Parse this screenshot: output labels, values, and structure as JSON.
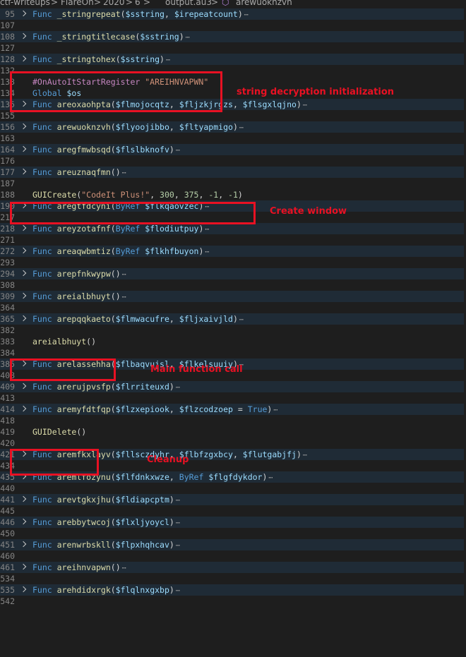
{
  "breadcrumb": {
    "items": [
      "ctf-writeups",
      "FlareOn",
      "2020",
      "6",
      "output.au3",
      "arewuoknzvh"
    ],
    "separator": ">"
  },
  "lines": [
    {
      "num": "95",
      "folded": true,
      "tokens": [
        [
          "kw",
          "Func "
        ],
        [
          "fn",
          "_stringrepeat"
        ],
        [
          "op",
          "("
        ],
        [
          "var",
          "$sstring"
        ],
        [
          "op",
          ", "
        ],
        [
          "var",
          "$irepeatcount"
        ],
        [
          "op",
          ")"
        ]
      ]
    },
    {
      "num": "107",
      "folded": false,
      "tokens": []
    },
    {
      "num": "108",
      "folded": true,
      "tokens": [
        [
          "kw",
          "Func "
        ],
        [
          "fn",
          "_stringtitlecase"
        ],
        [
          "op",
          "("
        ],
        [
          "var",
          "$sstring"
        ],
        [
          "op",
          ")"
        ]
      ]
    },
    {
      "num": "127",
      "folded": false,
      "tokens": []
    },
    {
      "num": "128",
      "folded": true,
      "tokens": [
        [
          "kw",
          "Func "
        ],
        [
          "fn",
          "_stringtohex"
        ],
        [
          "op",
          "("
        ],
        [
          "var",
          "$sstring"
        ],
        [
          "op",
          ")"
        ]
      ]
    },
    {
      "num": "132",
      "folded": false,
      "tokens": []
    },
    {
      "num": "133",
      "folded": false,
      "tokens": [
        [
          "dir",
          "#OnAutoItStartRegister "
        ],
        [
          "str",
          "\"AREIHNVAPWN\""
        ]
      ]
    },
    {
      "num": "134",
      "folded": false,
      "tokens": [
        [
          "kw",
          "Global "
        ],
        [
          "var",
          "$os"
        ]
      ]
    },
    {
      "num": "135",
      "folded": true,
      "tokens": [
        [
          "kw",
          "Func "
        ],
        [
          "fn",
          "areoxaohpta"
        ],
        [
          "op",
          "("
        ],
        [
          "var",
          "$flmojocqtz"
        ],
        [
          "op",
          ", "
        ],
        [
          "var",
          "$fljzkjrgzs"
        ],
        [
          "op",
          ", "
        ],
        [
          "var",
          "$flsgxlqjno"
        ],
        [
          "op",
          ")"
        ]
      ]
    },
    {
      "num": "155",
      "folded": false,
      "tokens": []
    },
    {
      "num": "156",
      "folded": true,
      "tokens": [
        [
          "kw",
          "Func "
        ],
        [
          "fn",
          "arewuoknzvh"
        ],
        [
          "op",
          "("
        ],
        [
          "var",
          "$flyoojibbo"
        ],
        [
          "op",
          ", "
        ],
        [
          "var",
          "$fltyapmigo"
        ],
        [
          "op",
          ")"
        ]
      ]
    },
    {
      "num": "163",
      "folded": false,
      "tokens": []
    },
    {
      "num": "164",
      "folded": true,
      "tokens": [
        [
          "kw",
          "Func "
        ],
        [
          "fn",
          "aregfmwbsqd"
        ],
        [
          "op",
          "("
        ],
        [
          "var",
          "$flslbknofv"
        ],
        [
          "op",
          ")"
        ]
      ]
    },
    {
      "num": "176",
      "folded": false,
      "tokens": []
    },
    {
      "num": "177",
      "folded": true,
      "tokens": [
        [
          "kw",
          "Func "
        ],
        [
          "fn",
          "areuznaqfmn"
        ],
        [
          "op",
          "()"
        ]
      ]
    },
    {
      "num": "187",
      "folded": false,
      "tokens": []
    },
    {
      "num": "188",
      "folded": false,
      "tokens": [
        [
          "fn",
          "GUICreate"
        ],
        [
          "op",
          "("
        ],
        [
          "str",
          "\"CodeIt Plus!\""
        ],
        [
          "op",
          ", "
        ],
        [
          "num",
          "300"
        ],
        [
          "op",
          ", "
        ],
        [
          "num",
          "375"
        ],
        [
          "op",
          ", "
        ],
        [
          "num",
          "-1"
        ],
        [
          "op",
          ", "
        ],
        [
          "num",
          "-1"
        ],
        [
          "op",
          ")"
        ]
      ]
    },
    {
      "num": "190",
      "folded": true,
      "tokens": [
        [
          "kw",
          "Func "
        ],
        [
          "fn",
          "aregtfdcyni"
        ],
        [
          "op",
          "("
        ],
        [
          "kw",
          "ByRef "
        ],
        [
          "var",
          "$flkqaovzec"
        ],
        [
          "op",
          ")"
        ]
      ]
    },
    {
      "num": "217",
      "folded": false,
      "tokens": []
    },
    {
      "num": "218",
      "folded": true,
      "tokens": [
        [
          "kw",
          "Func "
        ],
        [
          "fn",
          "areyzotafnf"
        ],
        [
          "op",
          "("
        ],
        [
          "kw",
          "ByRef "
        ],
        [
          "var",
          "$flodiutpuy"
        ],
        [
          "op",
          ")"
        ]
      ]
    },
    {
      "num": "271",
      "folded": false,
      "tokens": []
    },
    {
      "num": "272",
      "folded": true,
      "tokens": [
        [
          "kw",
          "Func "
        ],
        [
          "fn",
          "areaqwbmtiz"
        ],
        [
          "op",
          "("
        ],
        [
          "kw",
          "ByRef "
        ],
        [
          "var",
          "$flkhfbuyon"
        ],
        [
          "op",
          ")"
        ]
      ]
    },
    {
      "num": "293",
      "folded": false,
      "tokens": []
    },
    {
      "num": "294",
      "folded": true,
      "tokens": [
        [
          "kw",
          "Func "
        ],
        [
          "fn",
          "arepfnkwypw"
        ],
        [
          "op",
          "()"
        ]
      ]
    },
    {
      "num": "308",
      "folded": false,
      "tokens": []
    },
    {
      "num": "309",
      "folded": true,
      "tokens": [
        [
          "kw",
          "Func "
        ],
        [
          "fn",
          "areialbhuyt"
        ],
        [
          "op",
          "()"
        ]
      ]
    },
    {
      "num": "364",
      "folded": false,
      "tokens": []
    },
    {
      "num": "365",
      "folded": true,
      "tokens": [
        [
          "kw",
          "Func "
        ],
        [
          "fn",
          "arepqqkaeto"
        ],
        [
          "op",
          "("
        ],
        [
          "var",
          "$flmwacufre"
        ],
        [
          "op",
          ", "
        ],
        [
          "var",
          "$fljxaivjld"
        ],
        [
          "op",
          ")"
        ]
      ]
    },
    {
      "num": "382",
      "folded": false,
      "tokens": []
    },
    {
      "num": "383",
      "folded": false,
      "tokens": [
        [
          "fn",
          "areialbhuyt"
        ],
        [
          "op",
          "()"
        ]
      ]
    },
    {
      "num": "384",
      "folded": false,
      "tokens": []
    },
    {
      "num": "385",
      "folded": true,
      "tokens": [
        [
          "kw",
          "Func "
        ],
        [
          "fn",
          "arelassehha"
        ],
        [
          "op",
          "("
        ],
        [
          "var",
          "$flbaqvujsl"
        ],
        [
          "op",
          ", "
        ],
        [
          "var",
          "$flkelsuuiy"
        ],
        [
          "op",
          ")"
        ]
      ]
    },
    {
      "num": "408",
      "folded": false,
      "tokens": []
    },
    {
      "num": "409",
      "folded": true,
      "tokens": [
        [
          "kw",
          "Func "
        ],
        [
          "fn",
          "arerujpvsfp"
        ],
        [
          "op",
          "("
        ],
        [
          "var",
          "$flrriteuxd"
        ],
        [
          "op",
          ")"
        ]
      ]
    },
    {
      "num": "413",
      "folded": false,
      "tokens": []
    },
    {
      "num": "414",
      "folded": true,
      "tokens": [
        [
          "kw",
          "Func "
        ],
        [
          "fn",
          "aremyfdtfqp"
        ],
        [
          "op",
          "("
        ],
        [
          "var",
          "$flzxepiook"
        ],
        [
          "op",
          ", "
        ],
        [
          "var",
          "$flzcodzoep"
        ],
        [
          "op",
          " = "
        ],
        [
          "kw",
          "True"
        ],
        [
          "op",
          ")"
        ]
      ]
    },
    {
      "num": "418",
      "folded": false,
      "tokens": []
    },
    {
      "num": "419",
      "folded": false,
      "tokens": [
        [
          "fn",
          "GUIDelete"
        ],
        [
          "op",
          "()"
        ]
      ]
    },
    {
      "num": "420",
      "folded": false,
      "tokens": []
    },
    {
      "num": "421",
      "folded": true,
      "tokens": [
        [
          "kw",
          "Func "
        ],
        [
          "fn",
          "aremfkxlayv"
        ],
        [
          "op",
          "("
        ],
        [
          "var",
          "$fllsczdyhr"
        ],
        [
          "op",
          ", "
        ],
        [
          "var",
          "$flbfzgxbcy"
        ],
        [
          "op",
          ", "
        ],
        [
          "var",
          "$flutgabjfj"
        ],
        [
          "op",
          ")"
        ]
      ]
    },
    {
      "num": "434",
      "folded": false,
      "tokens": []
    },
    {
      "num": "435",
      "folded": true,
      "tokens": [
        [
          "kw",
          "Func "
        ],
        [
          "fn",
          "aremlfozynu"
        ],
        [
          "op",
          "("
        ],
        [
          "var",
          "$flfdnkxwze"
        ],
        [
          "op",
          ", "
        ],
        [
          "kw",
          "ByRef "
        ],
        [
          "var",
          "$flgfdykdor"
        ],
        [
          "op",
          ")"
        ]
      ]
    },
    {
      "num": "440",
      "folded": false,
      "tokens": []
    },
    {
      "num": "441",
      "folded": true,
      "tokens": [
        [
          "kw",
          "Func "
        ],
        [
          "fn",
          "arevtgkxjhu"
        ],
        [
          "op",
          "("
        ],
        [
          "var",
          "$fldiapcptm"
        ],
        [
          "op",
          ")"
        ]
      ]
    },
    {
      "num": "445",
      "folded": false,
      "tokens": []
    },
    {
      "num": "446",
      "folded": true,
      "tokens": [
        [
          "kw",
          "Func "
        ],
        [
          "fn",
          "arebbytwcoj"
        ],
        [
          "op",
          "("
        ],
        [
          "var",
          "$flxljyoycl"
        ],
        [
          "op",
          ")"
        ]
      ]
    },
    {
      "num": "450",
      "folded": false,
      "tokens": []
    },
    {
      "num": "451",
      "folded": true,
      "tokens": [
        [
          "kw",
          "Func "
        ],
        [
          "fn",
          "arenwrbskll"
        ],
        [
          "op",
          "("
        ],
        [
          "var",
          "$flpxhqhcav"
        ],
        [
          "op",
          ")"
        ]
      ]
    },
    {
      "num": "460",
      "folded": false,
      "tokens": []
    },
    {
      "num": "461",
      "folded": true,
      "tokens": [
        [
          "kw",
          "Func "
        ],
        [
          "fn",
          "areihnvapwn"
        ],
        [
          "op",
          "()"
        ]
      ]
    },
    {
      "num": "534",
      "folded": false,
      "tokens": []
    },
    {
      "num": "535",
      "folded": true,
      "tokens": [
        [
          "kw",
          "Func "
        ],
        [
          "fn",
          "arehdidxrgk"
        ],
        [
          "op",
          "("
        ],
        [
          "var",
          "$flqlnxgxbp"
        ],
        [
          "op",
          ")"
        ]
      ]
    },
    {
      "num": "542",
      "folded": false,
      "tokens": []
    }
  ],
  "annotations": {
    "string_decryption": "string decryption initialization",
    "create_window": "Create window",
    "main_call": "Main function call",
    "cleanup": "Cleanup"
  },
  "colors": {
    "background": "#1e1e1e",
    "folded_line": "#1f2b36",
    "annotation": "#e81123",
    "keyword": "#569cd6",
    "function": "#dcdcaa",
    "variable": "#9cdcfe",
    "string": "#ce9178",
    "number": "#b5cea8"
  },
  "icons": {
    "fold": "chevron-right-icon",
    "ellipsis": "folded-ellipsis-icon",
    "symbol": "cube-symbol-icon"
  }
}
